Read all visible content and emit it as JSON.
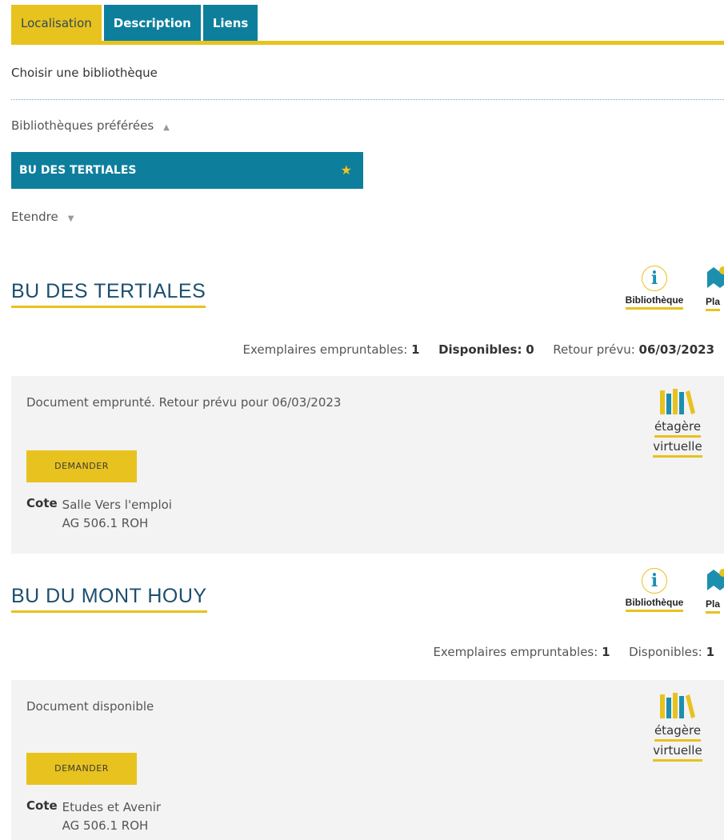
{
  "tabs": [
    {
      "label": "Localisation"
    },
    {
      "label": "Description"
    },
    {
      "label": "Liens"
    }
  ],
  "choose_library": "Choisir une bibliothèque",
  "preferred_libraries": {
    "label": "Bibliothèques préférées",
    "arrow": "▲"
  },
  "selected_library": "BU DES TERTIALES",
  "extend": {
    "label": "Etendre",
    "arrow": "▼"
  },
  "libraries": [
    {
      "name": "BU DES TERTIALES",
      "icon_label": "Bibliothèque",
      "plan_label": "Pla",
      "stats": {
        "borrowable_label": "Exemplaires empruntables:",
        "borrowable_value": "1",
        "available_label": "Disponibles:",
        "available_value": "0",
        "return_label": "Retour prévu:",
        "return_value": "06/03/2023"
      },
      "status": "Document emprunté. Retour prévu pour 06/03/2023",
      "request_label": "DEMANDER",
      "cote_label": "Cote",
      "cote_line1": "Salle Vers l'emploi",
      "cote_line2": "AG 506.1 ROH",
      "shelf_line1": "étagère",
      "shelf_line2": "virtuelle"
    },
    {
      "name": "BU DU MONT HOUY",
      "icon_label": "Bibliothèque",
      "plan_label": "Pla",
      "stats": {
        "borrowable_label": "Exemplaires empruntables:",
        "borrowable_value": "1",
        "available_label": "Disponibles:",
        "available_value": "1"
      },
      "status": "Document disponible",
      "request_label": "DEMANDER",
      "cote_label": "Cote",
      "cote_line1": "Etudes et Avenir",
      "cote_line2": "AG 506.1 ROH",
      "shelf_line1": "étagère",
      "shelf_line2": "virtuelle"
    }
  ],
  "colors": {
    "accent": "#e8c21e",
    "primary": "#0d7f9c",
    "title": "#1c4e6f"
  },
  "icons": [
    "info-icon",
    "map-icon",
    "star-icon",
    "bookshelf-icon"
  ]
}
